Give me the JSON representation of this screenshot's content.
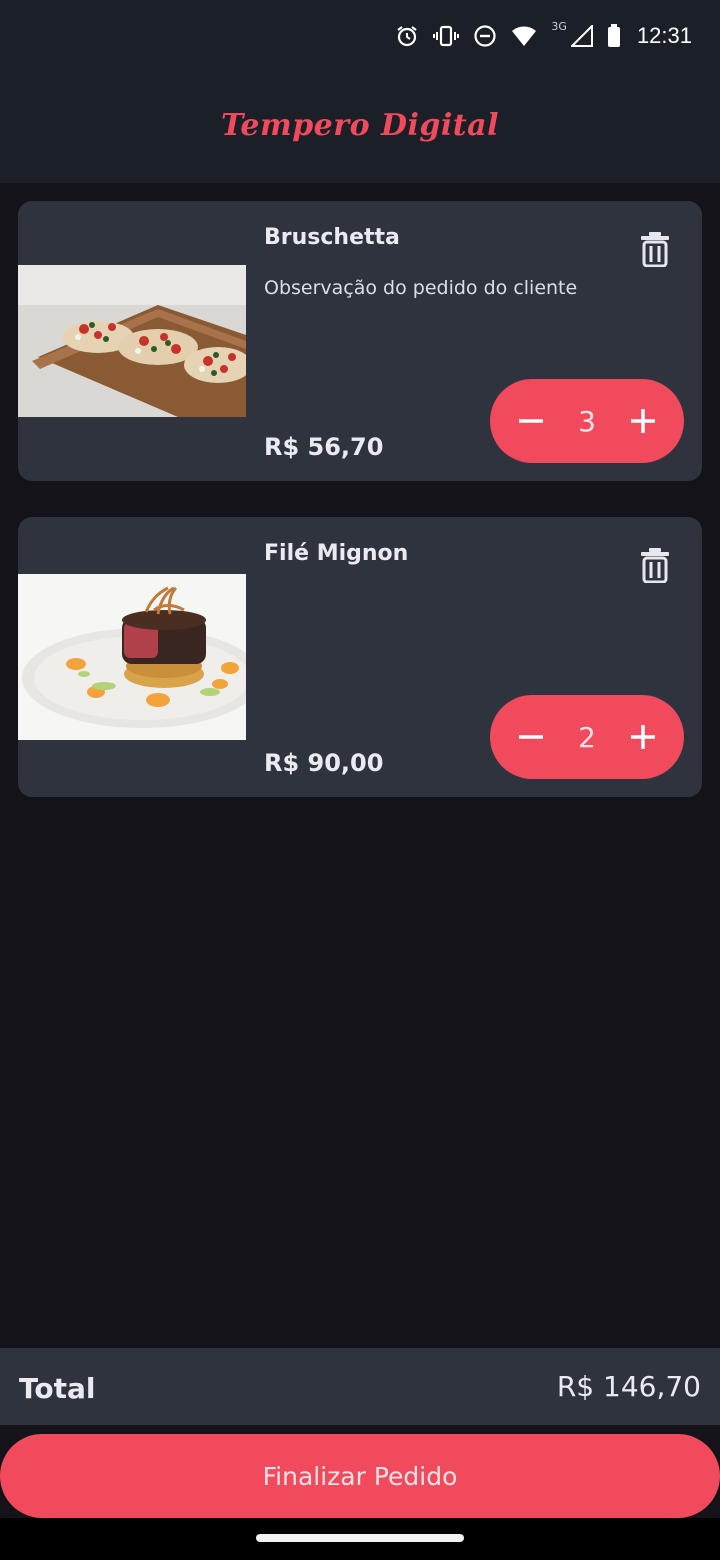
{
  "status_bar": {
    "time": "12:31",
    "network_label": "3G",
    "icons": [
      "alarm-icon",
      "vibrate-icon",
      "do-not-disturb-icon",
      "wifi-icon",
      "signal-icon",
      "battery-icon"
    ]
  },
  "app": {
    "title": "Tempero Digital",
    "accent_color": "#f04a5c"
  },
  "cart": {
    "items": [
      {
        "name": "Bruschetta",
        "note": "Observação do pedido do cliente",
        "price": "R$ 56,70",
        "quantity": "3",
        "image": "bruschetta-photo"
      },
      {
        "name": "Filé Mignon",
        "note": "",
        "price": "R$ 90,00",
        "quantity": "2",
        "image": "file-mignon-photo"
      }
    ]
  },
  "summary": {
    "total_label": "Total",
    "total_value": "R$ 146,70"
  },
  "actions": {
    "finish_label": "Finalizar Pedido"
  }
}
